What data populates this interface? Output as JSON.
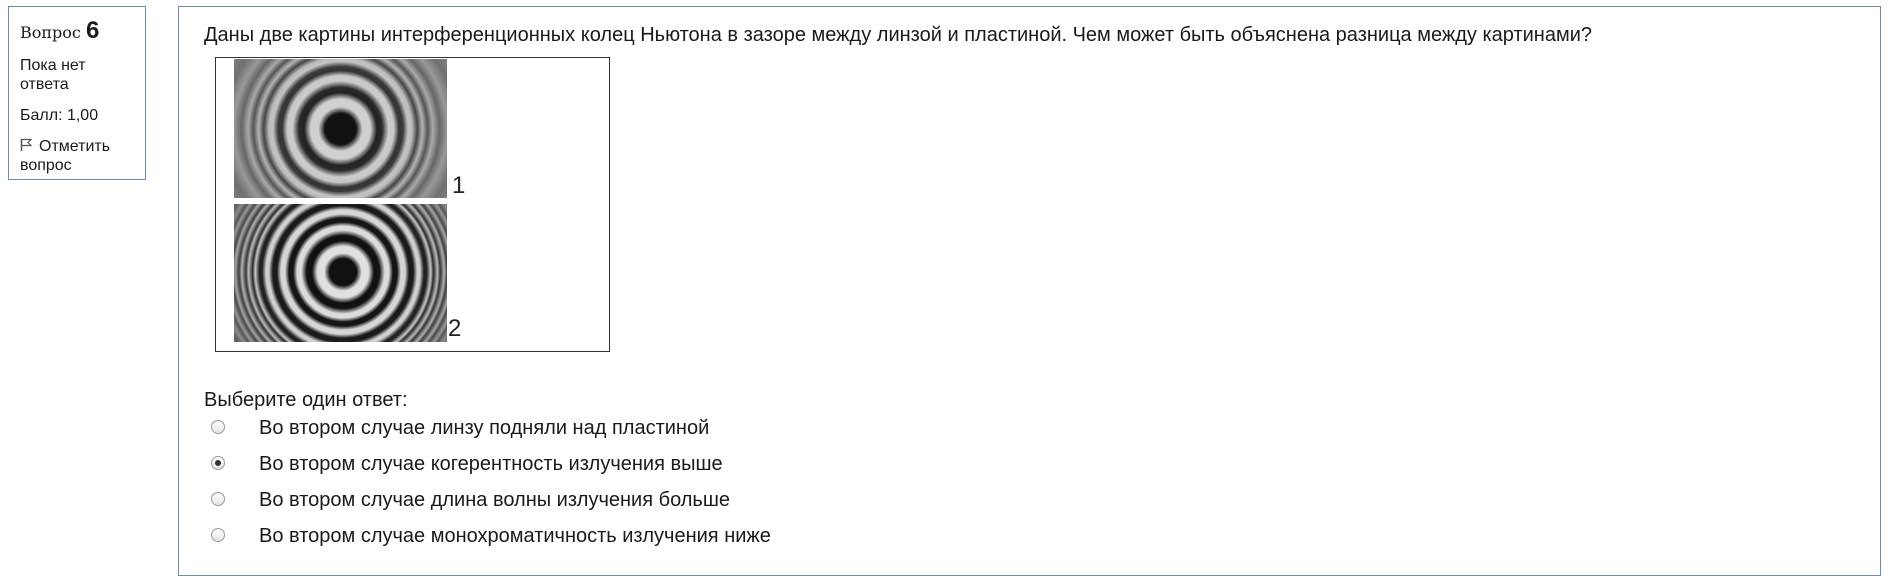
{
  "info": {
    "question_prefix": "Вопрос",
    "question_number": "6",
    "state": "Пока нет ответа",
    "grade": "Балл: 1,00",
    "flag_label": "Отметить вопрос"
  },
  "question": {
    "text": "Даны две картины интерференционных колец Ньютона в зазоре между линзой и пластиной. Чем может быть объяснена разница между картинами?",
    "figure_labels": [
      "1",
      "2"
    ],
    "prompt": "Выберите один ответ:",
    "options": [
      {
        "label": "Во втором случае линзу подняли над пластиной",
        "checked": false
      },
      {
        "label": "Во втором случае когерентность излучения выше",
        "checked": true
      },
      {
        "label": "Во втором случае длина волны излучения больше",
        "checked": false
      },
      {
        "label": "Во втором случае монохроматичность излучения ниже",
        "checked": false
      }
    ]
  },
  "colors": {
    "panel_border": "#6c89b5",
    "text": "#1a1a1a"
  }
}
